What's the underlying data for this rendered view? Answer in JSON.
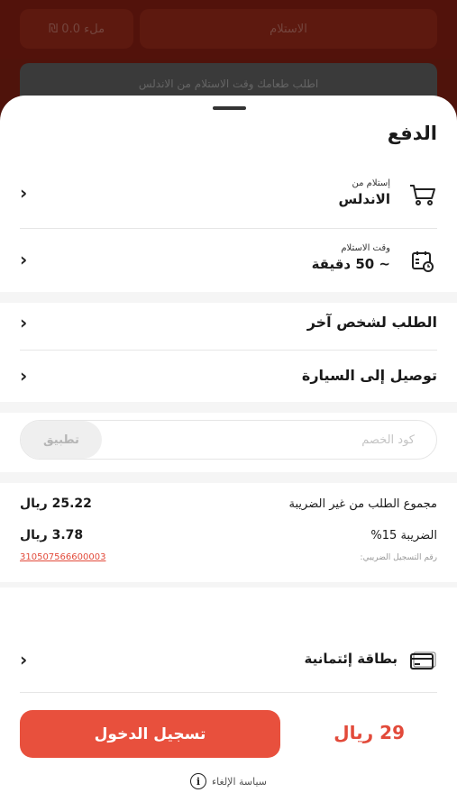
{
  "background": {
    "top_left_button": "₪ 0.0 ملء",
    "top_right_button": "الاستلام",
    "banner_text": "اطلب طعامك وقت الاستلام من الاندلس"
  },
  "sheet": {
    "title": "الدفع",
    "pickup": {
      "label": "إستلام من",
      "value": "الاندلس"
    },
    "pickup_time": {
      "label": "وقت الاستلام",
      "value": "~ 50 دقيقة"
    },
    "order_for_other": "الطلب لشخص آخر",
    "car_delivery": "توصيل إلى السيارة",
    "coupon": {
      "placeholder": "كود الخصم",
      "apply": "تطبيق"
    },
    "summary": {
      "subtotal_label": "مجموع الطلب من غير الضريبة",
      "subtotal_value": "25.22 ريال",
      "tax_label": "الضريبة 15%",
      "tax_value": "3.78 ريال",
      "tax_reg_label": "رقم التسجيل الضريبي:",
      "tax_reg_number": "310507566600003"
    },
    "payment_method": "بطاقة إئتمانية",
    "total": "29 ريال",
    "login_button": "تسجيل الدخول",
    "cancel_policy": "سياسة الإلغاء"
  },
  "colors": {
    "accent": "#e8503d",
    "accent_text": "#e24a3a"
  }
}
